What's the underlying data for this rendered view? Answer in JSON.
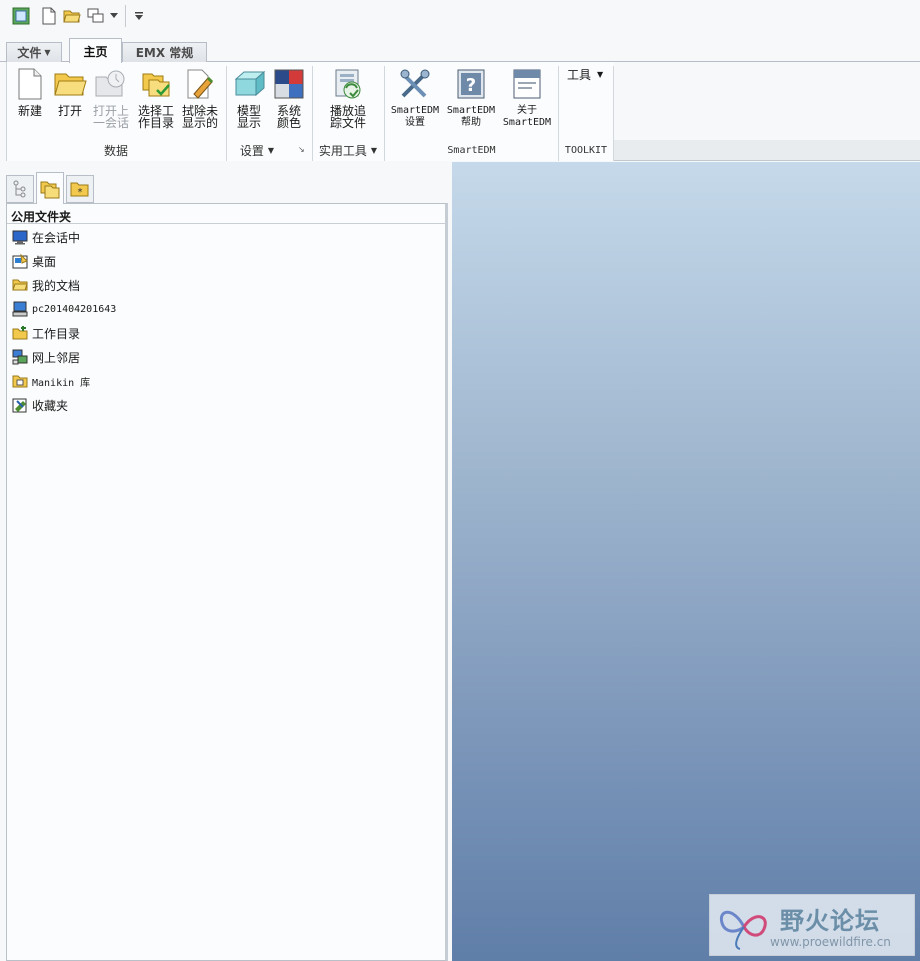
{
  "quick_access": {
    "icons": [
      "app-window-icon",
      "new-file-icon",
      "open-folder-icon",
      "windows-icon",
      "dropdown-arrow-icon",
      "customize-toolbar-icon"
    ]
  },
  "tabs": [
    {
      "label": "文件",
      "has_menu": true
    },
    {
      "label": "主页",
      "active": true
    },
    {
      "label": "EMX 常规"
    }
  ],
  "ribbon": {
    "buttons": {
      "new": "新建",
      "open": "打开",
      "open_last": "打开上\n一会话",
      "select_workdir": "选择工\n作目录",
      "erase_undisplayed": "拭除未\n显示的",
      "model_display": "模型\n显示",
      "system_colors": "系统\n颜色",
      "play_trail": "播放追\n踪文件",
      "smartedm_settings": "SmartEDM\n设置",
      "smartedm_help": "SmartEDM\n帮助",
      "about_smartedm": "关于\nSmartEDM"
    },
    "tools_menu": "工具",
    "groups": {
      "data": "数据",
      "settings": "设置",
      "utilities": "实用工具",
      "smartedm": "SmartEDM",
      "toolkit": "TOOLKIT"
    }
  },
  "navigator": {
    "header": "公用文件夹",
    "items": [
      {
        "label": "在会话中",
        "icon": "monitor-icon"
      },
      {
        "label": "桌面",
        "icon": "desktop-icon"
      },
      {
        "label": "我的文档",
        "icon": "folder-open-icon"
      },
      {
        "label": "pc201404201643",
        "icon": "computer-icon"
      },
      {
        "label": "工作目录",
        "icon": "work-folder-icon"
      },
      {
        "label": "网上邻居",
        "icon": "network-icon"
      },
      {
        "label": "Manikin 库",
        "icon": "library-folder-icon"
      },
      {
        "label": "收藏夹",
        "icon": "favorites-icon"
      }
    ]
  },
  "colors": {
    "graphics_top": "#c5d9ea",
    "graphics_bottom": "#5f7ea8",
    "accent": "#6b8fa8"
  },
  "watermark": {
    "title": "野火论坛",
    "url": "www.proewildfire.cn"
  }
}
